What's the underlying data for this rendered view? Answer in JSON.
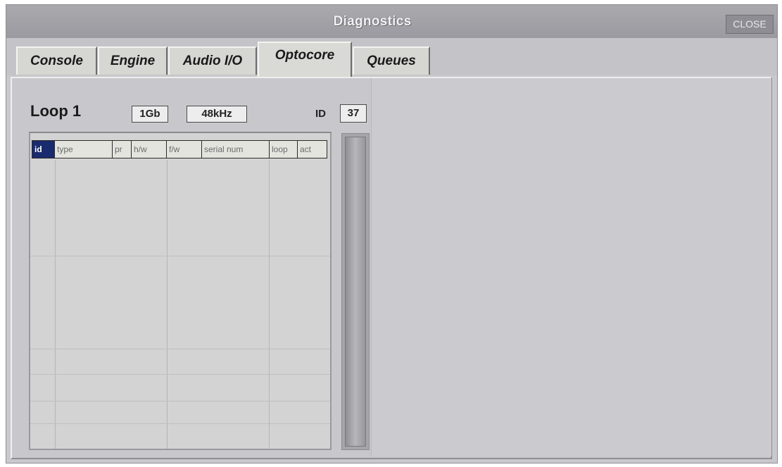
{
  "window": {
    "title": "Diagnostics",
    "close_label": "CLOSE"
  },
  "tabs": [
    {
      "label": "Console",
      "active": false
    },
    {
      "label": "Engine",
      "active": false
    },
    {
      "label": "Audio I/O",
      "active": false
    },
    {
      "label": "Optocore",
      "active": true
    },
    {
      "label": "Queues",
      "active": false
    }
  ],
  "optocore": {
    "loop_label": "Loop 1",
    "speed": "1Gb",
    "sample_rate": "48kHz",
    "id_label": "ID",
    "id_value": "37",
    "table": {
      "columns": [
        "id",
        "type",
        "pr",
        "h/w",
        "f/w",
        "serial num",
        "loop",
        "act"
      ],
      "rows": []
    }
  },
  "colors": {
    "window_bg": "#c9c9cd",
    "titlebar": "#9a9aa0",
    "header_selected": "#1a2a6e",
    "tab_bg": "#d6d6d2"
  }
}
